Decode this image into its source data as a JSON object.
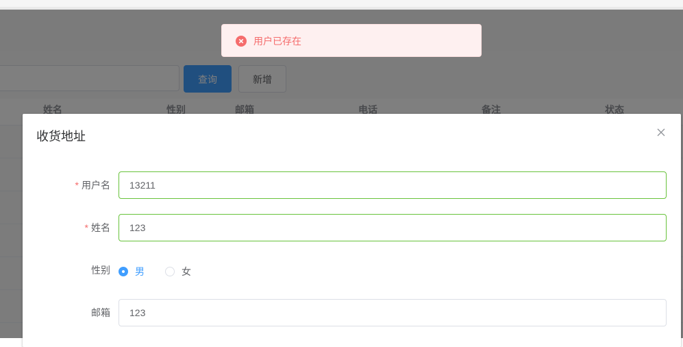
{
  "toast": {
    "message": "用户已存在",
    "icon": "error-circle-icon",
    "color": "#f56c6c"
  },
  "toolbar": {
    "query_label": "查询",
    "add_label": "新增"
  },
  "table": {
    "columns": [
      "姓名",
      "性别",
      "邮箱",
      "电话",
      "备注",
      "状态"
    ]
  },
  "dialog": {
    "title": "收货地址",
    "fields": {
      "username": {
        "label": "用户名",
        "required": "*",
        "value": "13211"
      },
      "name": {
        "label": "姓名",
        "required": "*",
        "value": "123"
      },
      "gender": {
        "label": "性别",
        "options": [
          "男",
          "女"
        ],
        "selected": "男"
      },
      "email": {
        "label": "邮箱",
        "value": "123"
      }
    }
  },
  "colors": {
    "primary": "#409eff",
    "success": "#67c23a",
    "danger": "#f56c6c"
  }
}
